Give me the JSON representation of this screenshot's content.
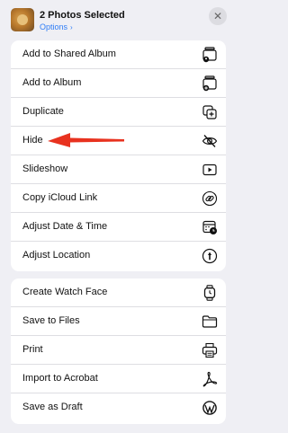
{
  "header": {
    "title": "2 Photos Selected",
    "options_label": "Options",
    "options_chevron": "›",
    "close_glyph": "✕"
  },
  "menu_groups": [
    {
      "items": [
        {
          "label": "Add to Shared Album",
          "icon": "shared-album-icon"
        },
        {
          "label": "Add to Album",
          "icon": "album-add-icon"
        },
        {
          "label": "Duplicate",
          "icon": "duplicate-icon"
        },
        {
          "label": "Hide",
          "icon": "hide-eye-slash-icon"
        },
        {
          "label": "Slideshow",
          "icon": "slideshow-play-icon"
        },
        {
          "label": "Copy iCloud Link",
          "icon": "link-icon"
        },
        {
          "label": "Adjust Date & Time",
          "icon": "calendar-clock-icon"
        },
        {
          "label": "Adjust Location",
          "icon": "location-info-icon"
        }
      ]
    },
    {
      "items": [
        {
          "label": "Create Watch Face",
          "icon": "watch-icon"
        },
        {
          "label": "Save to Files",
          "icon": "folder-icon"
        },
        {
          "label": "Print",
          "icon": "printer-icon"
        },
        {
          "label": "Import to Acrobat",
          "icon": "acrobat-icon"
        },
        {
          "label": "Save as Draft",
          "icon": "wordpress-icon"
        }
      ]
    }
  ],
  "annotation": {
    "type": "red-arrow",
    "points_to": "Hide",
    "color": "#e8321f"
  },
  "colors": {
    "accent": "#2f7df6",
    "background": "#efeff4",
    "card": "#ffffff"
  }
}
